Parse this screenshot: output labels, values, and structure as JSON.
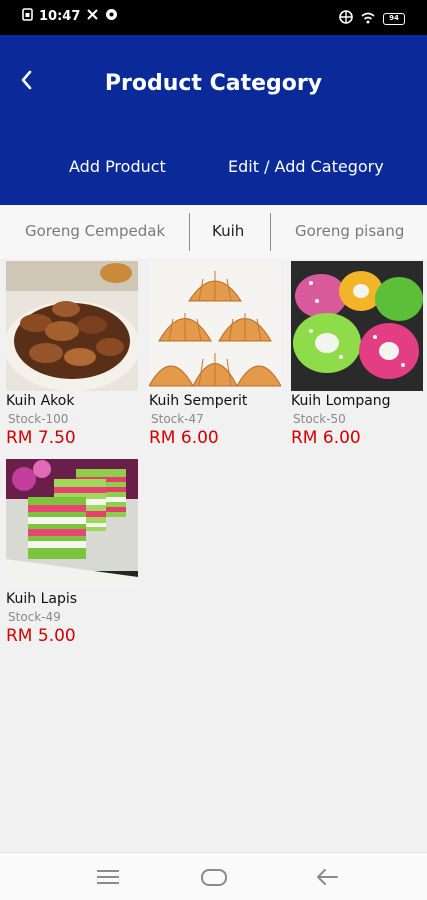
{
  "status": {
    "time": "10:47",
    "battery": "94"
  },
  "header": {
    "title": "Product Category",
    "add_product": "Add Product",
    "edit_category": "Edit / Add Category"
  },
  "tabs": [
    {
      "label": "Goreng Cempedak",
      "active": false
    },
    {
      "label": "Kuih",
      "active": true
    },
    {
      "label": "Goreng pisang",
      "active": false
    }
  ],
  "products": [
    {
      "name": "Kuih Akok",
      "stock": "Stock-100",
      "price": "RM 7.50"
    },
    {
      "name": "Kuih Semperit",
      "stock": "Stock-47",
      "price": "RM 6.00"
    },
    {
      "name": "Kuih Lompang",
      "stock": "Stock-50",
      "price": "RM 6.00"
    },
    {
      "name": "Kuih Lapis",
      "stock": "Stock-49",
      "price": "RM 5.00"
    }
  ],
  "colors": {
    "header": "#0a2a9a",
    "price": "#d40000"
  },
  "icons": {
    "back": "chevron-left-icon",
    "nav_menu": "menu-icon",
    "nav_home": "home-icon",
    "nav_back": "back-arrow-icon"
  }
}
